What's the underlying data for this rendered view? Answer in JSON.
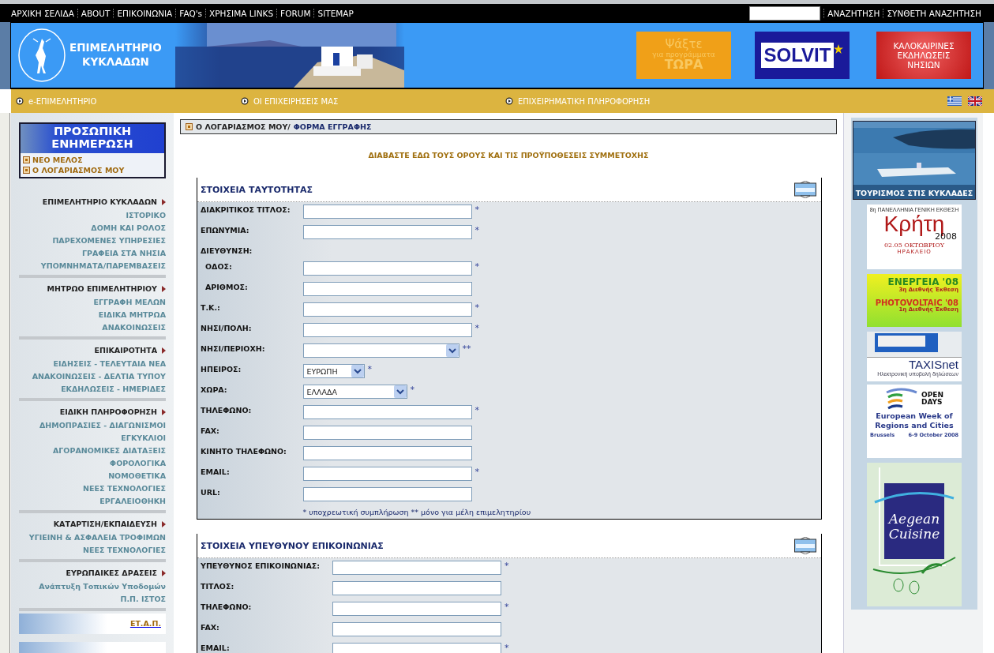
{
  "top_bar": {
    "links": [
      "ΑΡΧΙΚΗ ΣΕΛΙΔΑ",
      "ABOUT",
      "ΕΠΙΚΟΙΝΩΝΙΑ",
      "FAQ's",
      "ΧΡΗΣΙΜΑ LINKS",
      "FORUM",
      "SITEMAP"
    ],
    "search_links": [
      "ΑΝΑΖΗΤΗΣΗ",
      "ΣΥΝΘΕΤΗ ΑΝΑΖΗΤΗΣΗ"
    ]
  },
  "header": {
    "logo": "ΕΠΙΜΕΛΗΤΗΡΙΟ\nΚΥΚΛΑΔΩΝ",
    "banners": [
      {
        "kind": "promo",
        "lines": [
          "Ψάξτε",
          "για προγράμματα",
          "ΤΩΡΑ"
        ]
      },
      {
        "kind": "solvit",
        "lines": [
          "SOLVIT"
        ]
      },
      {
        "kind": "events",
        "lines": [
          "ΚΑΛΟΚΑΙΡΙΝΕΣ",
          "ΕΚΔΗΛΩΣΕΙΣ",
          "ΝΗΣΙΩΝ"
        ]
      }
    ]
  },
  "nav": {
    "items": [
      "e-ΕΠΙΜΕΛΗΤΗΡΙΟ",
      "ΟΙ ΕΠΙΧΕΙΡΗΣΕΙΣ ΜΑΣ",
      "ΕΠΙΧΕΙΡΗΜΑΤΙΚΗ ΠΛΗΡΟΦΟΡΗΣΗ"
    ]
  },
  "sidebar": {
    "personal": {
      "title": "ΠΡΟΣΩΠΙΚΗ ΕΝΗΜΕΡΩΣΗ",
      "links": [
        "ΝΕΟ ΜΕΛΟΣ",
        "Ο ΛΟΓΑΡΙΑΣΜΟΣ ΜΟΥ"
      ]
    },
    "sections": [
      {
        "title": "ΕΠΙΜΕΛΗΤΗΡΙΟ ΚΥΚΛΑΔΩΝ",
        "items": [
          "ΙΣΤΟΡΙΚΟ",
          "ΔΟΜΗ ΚΑΙ ΡΟΛΟΣ",
          "ΠΑΡΕΧΟΜΕΝΕΣ ΥΠΗΡΕΣΙΕΣ",
          "ΓΡΑΦΕΙΑ ΣΤΑ ΝΗΣΙΑ",
          "ΥΠΟΜΝΗΜΑΤΑ/ΠΑΡΕΜΒΑΣΕΙΣ"
        ]
      },
      {
        "title": "ΜΗΤΡΩΟ ΕΠΙΜΕΛΗΤΗΡΙΟΥ",
        "items": [
          "ΕΓΓΡΑΦΗ ΜΕΛΩΝ",
          "ΕΙΔΙΚΑ ΜΗΤΡΩΑ",
          "ΑΝΑΚΟΙΝΩΣΕΙΣ"
        ]
      },
      {
        "title": "ΕΠΙΚΑΙΡΟΤΗΤΑ",
        "items": [
          "ΕΙΔΗΣΕΙΣ - ΤΕΛΕΥΤΑΙΑ ΝΕΑ",
          "ΑΝΑΚΟΙΝΩΣΕΙΣ - ΔΕΛΤΙΑ ΤΥΠΟΥ",
          "ΕΚΔΗΛΩΣΕΙΣ - ΗΜΕΡΙΔΕΣ"
        ]
      },
      {
        "title": "ΕΙΔΙΚΗ ΠΛΗΡΟΦΟΡΗΣΗ",
        "items": [
          "ΔΗΜΟΠΡΑΣΙΕΣ - ΔΙΑΓΩΝΙΣΜΟΙ",
          "ΕΓΚΥΚΛΙΟΙ",
          "ΑΓΟΡΑΝΟΜΙΚΕΣ ΔΙΑΤΑΞΕΙΣ",
          "ΦΟΡΟΛΟΓΙΚΑ",
          "ΝΟΜΟΘΕΤΙΚΑ",
          "ΝΕΕΣ ΤΕΧΝΟΛΟΓΙΕΣ",
          "ΕΡΓΑΛΕΙΟΘΗΚΗ"
        ]
      },
      {
        "title": "ΚΑΤΑΡΤΙΣΗ/ΕΚΠΑΙΔΕΥΣΗ",
        "items": [
          "ΥΓΙΕΙΝΗ & ΑΣΦΑΛΕΙΑ ΤΡΟΦΙΜΩΝ",
          "ΝΕΕΣ ΤΕΧΝΟΛΟΓΙΕΣ"
        ]
      },
      {
        "title": "ΕΥΡΩΠΑΙΚΕΣ ΔΡΑΣΕΙΣ",
        "items": [
          "Ανάπτυξη Τοπικών Υποδομών",
          "Π.Π. ΙΣΤΟΣ"
        ]
      }
    ],
    "banners": [
      "ΕΤ.Α.Π."
    ]
  },
  "breadcrumb": {
    "parent": "Ο ΛΟΓΑΡΙΑΣΜΟΣ ΜΟΥ/",
    "current": "ΦΟΡΜΑ ΕΓΓΡΑΦΗΣ"
  },
  "terms_link": "ΔΙΑΒΑΣΤΕ ΕΔΩ ΤΟΥΣ ΟΡΟΥΣ ΚΑΙ ΤΙΣ ΠΡΟΫΠΟΘΕΣΕΙΣ ΣΥΜΜΕΤΟΧΗΣ",
  "form_sections": [
    {
      "title": "ΣΤΟΙΧΕΙΑ ΤΑΥΤΟΤΗΤΑΣ",
      "fields": [
        {
          "label": "ΔΙΑΚΡΙΤΙΚΟΣ ΤΙΤΛΟΣ:",
          "kind": "text",
          "required": "*"
        },
        {
          "label": "ΕΠΩΝΥΜΙΑ:",
          "kind": "text",
          "required": "*"
        },
        {
          "label": "ΔΙΕΥΘΥΝΣΗ:",
          "kind": "group",
          "children": [
            {
              "label": "ΟΔΟΣ:",
              "kind": "text",
              "required": "*"
            },
            {
              "label": "ΑΡΙΘΜΟΣ:",
              "kind": "text"
            }
          ]
        },
        {
          "label": "Τ.Κ.:",
          "kind": "text",
          "required": "*"
        },
        {
          "label": "ΝΗΣΙ/ΠΟΛΗ:",
          "kind": "text",
          "required": "*"
        },
        {
          "label": "ΝΗΣΙ/ΠΕΡΙΟΧΗ:",
          "kind": "select",
          "required": "**"
        },
        {
          "label": "ΗΠΕΙΡΟΣ:",
          "kind": "select",
          "value": "ΕΥΡΩΠΗ",
          "required": "*"
        },
        {
          "label": "ΧΩΡΑ:",
          "kind": "select",
          "value": "ΕΛΛΑΔΑ",
          "required": "*"
        },
        {
          "label": "ΤΗΛΕΦΩΝΟ:",
          "kind": "text",
          "required": "*"
        },
        {
          "label": "FAX:",
          "kind": "text"
        },
        {
          "label": "ΚΙΝΗΤΟ ΤΗΛΕΦΩΝΟ:",
          "kind": "text"
        },
        {
          "label": "EMAIL:",
          "kind": "text",
          "required": "*"
        },
        {
          "label": "URL:",
          "kind": "text"
        }
      ],
      "note": "* υποχρεωτική συμπλήρωση ** μόνο για μέλη επιμελητηρίου"
    },
    {
      "title": "ΣΤΟΙΧΕΙΑ ΥΠΕΥΘΥΝΟΥ ΕΠΙΚΟΙΝΩΝΙΑΣ",
      "fields": [
        {
          "label": "ΥΠΕΥΘΥΝΟΣ ΕΠΙΚΟΙΝΩΝΙΑΣ:",
          "kind": "text",
          "required": "*"
        },
        {
          "label": "ΤΙΤΛΟΣ:",
          "kind": "text"
        },
        {
          "label": "ΤΗΛΕΦΩΝΟ:",
          "kind": "text",
          "required": "*"
        },
        {
          "label": "FAX:",
          "kind": "text"
        },
        {
          "label": "EMAIL:",
          "kind": "text",
          "required": "*"
        }
      ]
    }
  ],
  "ads": [
    {
      "caption": "ΤΟΥΡΙΣΜΟΣ ΣΤΙΣ ΚΥΚΛΑΔΕΣ"
    },
    {
      "kind": "expo",
      "lines": [
        "8η ΠΑΝΕΛΛΗΝΙΑ ΓΕΝΙΚΗ ΕΚΘΕΣΗ",
        "Κρήτη",
        "2008",
        "02.05 ΟΚΤΩΒΡΙΟΥ",
        "ΗΡΑΚΛΕΙΟ"
      ]
    },
    {
      "kind": "energy",
      "lines": [
        "ΕΝΕΡΓΕΙΑ '08",
        "3η Διεθνής Έκθεση",
        "PHOTOVOLTAIC '08",
        "1η Διεθνής Έκθεση"
      ]
    },
    {
      "kind": "taxis",
      "lines": [
        "TAXISnet",
        "Ηλεκτρονική υποβολή δηλώσεων"
      ]
    },
    {
      "kind": "opendays",
      "lines": [
        "OPEN",
        "DAYS",
        "European Week of Regions and Cities",
        "Brussels",
        "6-9 October 2008"
      ]
    },
    {
      "kind": "cuisine",
      "lines": [
        "Aegean",
        "Cuisine"
      ]
    }
  ]
}
